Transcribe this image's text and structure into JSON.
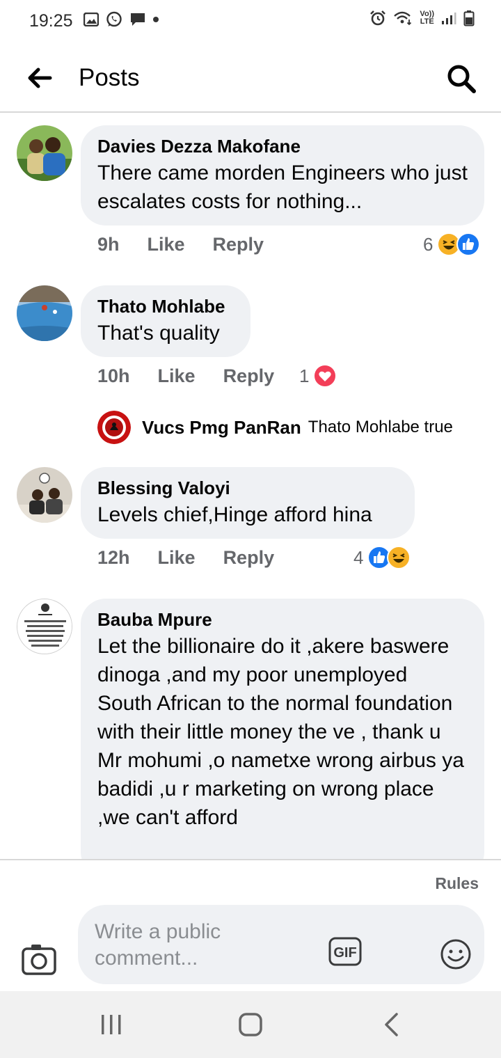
{
  "status_bar": {
    "time": "19:25",
    "left_icons": [
      "gallery-icon",
      "whatsapp-icon",
      "message-icon",
      "dot-icon"
    ],
    "right_icons": [
      "alarm-icon",
      "wifi-icon",
      "volte-icon",
      "signal-icon",
      "battery-icon"
    ],
    "volte_label_top": "Vo))",
    "volte_label_bottom": "LTE"
  },
  "header": {
    "title": "Posts",
    "back_icon": "arrow-left-icon",
    "search_icon": "search-icon"
  },
  "comments": [
    {
      "author": "Davies Dezza Makofane",
      "text": "There came morden Engineers who just escalates costs for nothing...",
      "time": "9h",
      "like_label": "Like",
      "reply_label": "Reply",
      "reaction_count": "6",
      "reactions": [
        "haha",
        "like"
      ]
    },
    {
      "author": "Thato Mohlabe",
      "text": "That's quality",
      "time": "10h",
      "like_label": "Like",
      "reply_label": "Reply",
      "reaction_count": "1",
      "reactions": [
        "love"
      ],
      "reply_preview": {
        "author": "Vucs Pmg PanRan",
        "text": "Thato Mohlabe true"
      }
    },
    {
      "author": "Blessing Valoyi",
      "text": "Levels chief,Hinge afford hina",
      "time": "12h",
      "like_label": "Like",
      "reply_label": "Reply",
      "reaction_count": "4",
      "reactions": [
        "like",
        "haha"
      ]
    },
    {
      "author": "Bauba Mpure",
      "text": "Let the billionaire do it ,akere baswere dinoga ,and my poor unemployed South African to the normal foundation with their little money the ve , thank u Mr mohumi ,o nametxe wrong airbus ya badidi ,u r marketing on wrong place ,we can't afford"
    }
  ],
  "composer": {
    "rules_label": "Rules",
    "placeholder": "Write a public comment...",
    "gif_label": "GIF"
  },
  "colors": {
    "bubble_bg": "#eff1f4",
    "meta_text": "#65676b",
    "like_blue": "#1877f2",
    "love_red": "#f33e58",
    "haha_yellow": "#f7b125"
  }
}
